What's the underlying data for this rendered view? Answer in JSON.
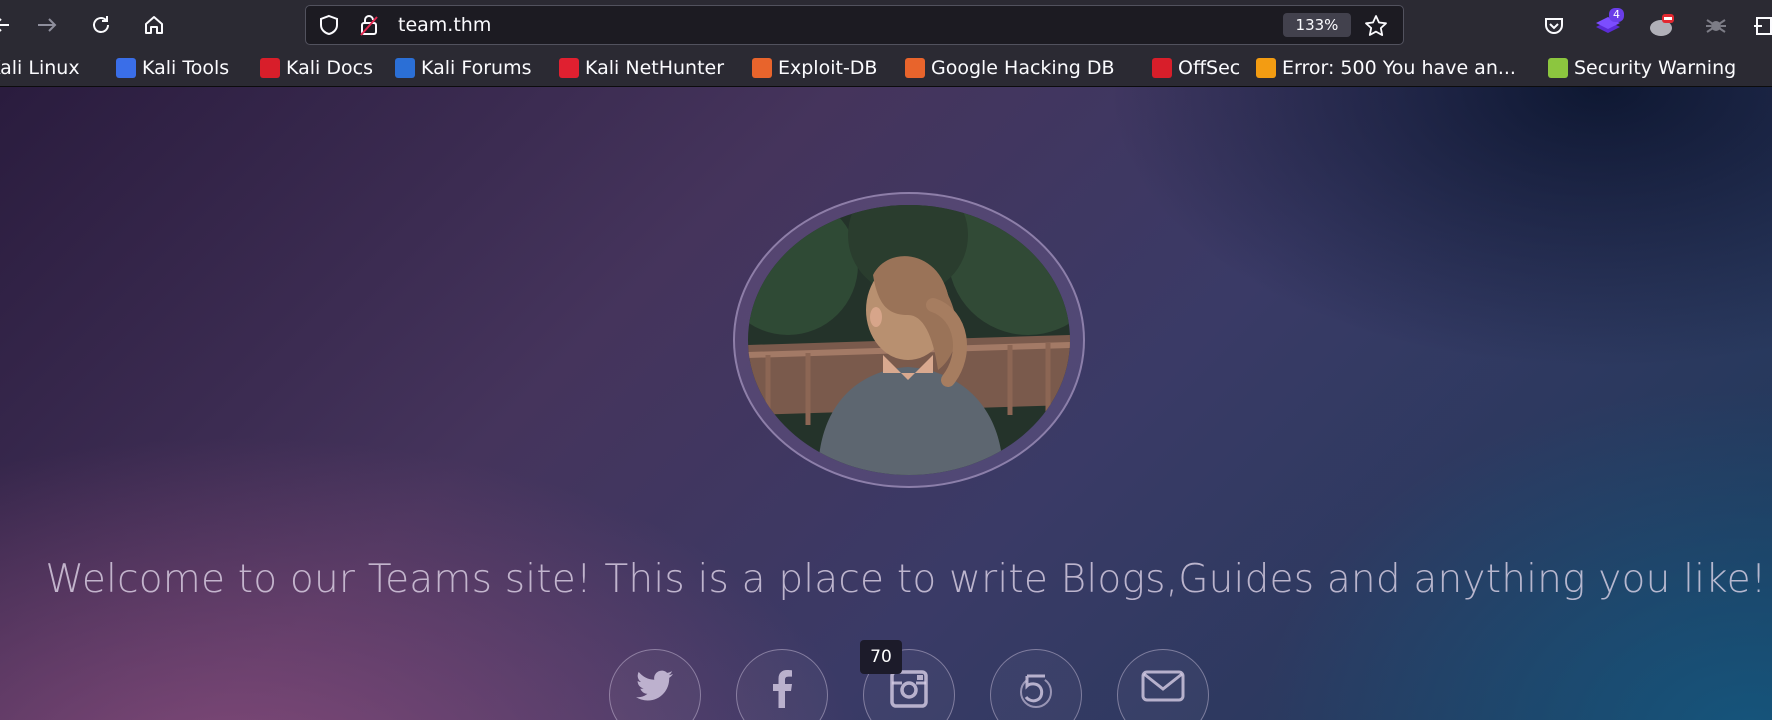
{
  "browser": {
    "url": "team.thm",
    "zoom": "133%",
    "extension_badge": "4"
  },
  "bookmarks": [
    {
      "label": "Kali Linux",
      "icon": "kali-icon",
      "color": "#367bf0"
    },
    {
      "label": "Kali Tools",
      "icon": "kali-tools-icon",
      "color": "#3a6ee8"
    },
    {
      "label": "Kali Docs",
      "icon": "kali-docs-icon",
      "color": "#d81e2a"
    },
    {
      "label": "Kali Forums",
      "icon": "kali-forums-icon",
      "color": "#2b6fd6"
    },
    {
      "label": "Kali NetHunter",
      "icon": "nethunter-icon",
      "color": "#e02030"
    },
    {
      "label": "Exploit-DB",
      "icon": "exploit-db-icon",
      "color": "#e8642c"
    },
    {
      "label": "Google Hacking DB",
      "icon": "ghdb-icon",
      "color": "#e8642c"
    },
    {
      "label": "OffSec",
      "icon": "offsec-icon",
      "color": "#d81e2a"
    },
    {
      "label": "Error: 500 You have an...",
      "icon": "joomla-icon",
      "color": "#f39c12"
    },
    {
      "label": "Security Warning",
      "icon": "security-warning-icon",
      "color": "#8cc63f"
    }
  ],
  "page": {
    "welcome_text": "Welcome to our Teams site! This is a place to write Blogs,Guides and anything you like!",
    "tooltip": "70",
    "social": [
      "twitter-icon",
      "facebook-icon",
      "instagram-icon",
      "500px-icon",
      "mail-icon"
    ]
  }
}
